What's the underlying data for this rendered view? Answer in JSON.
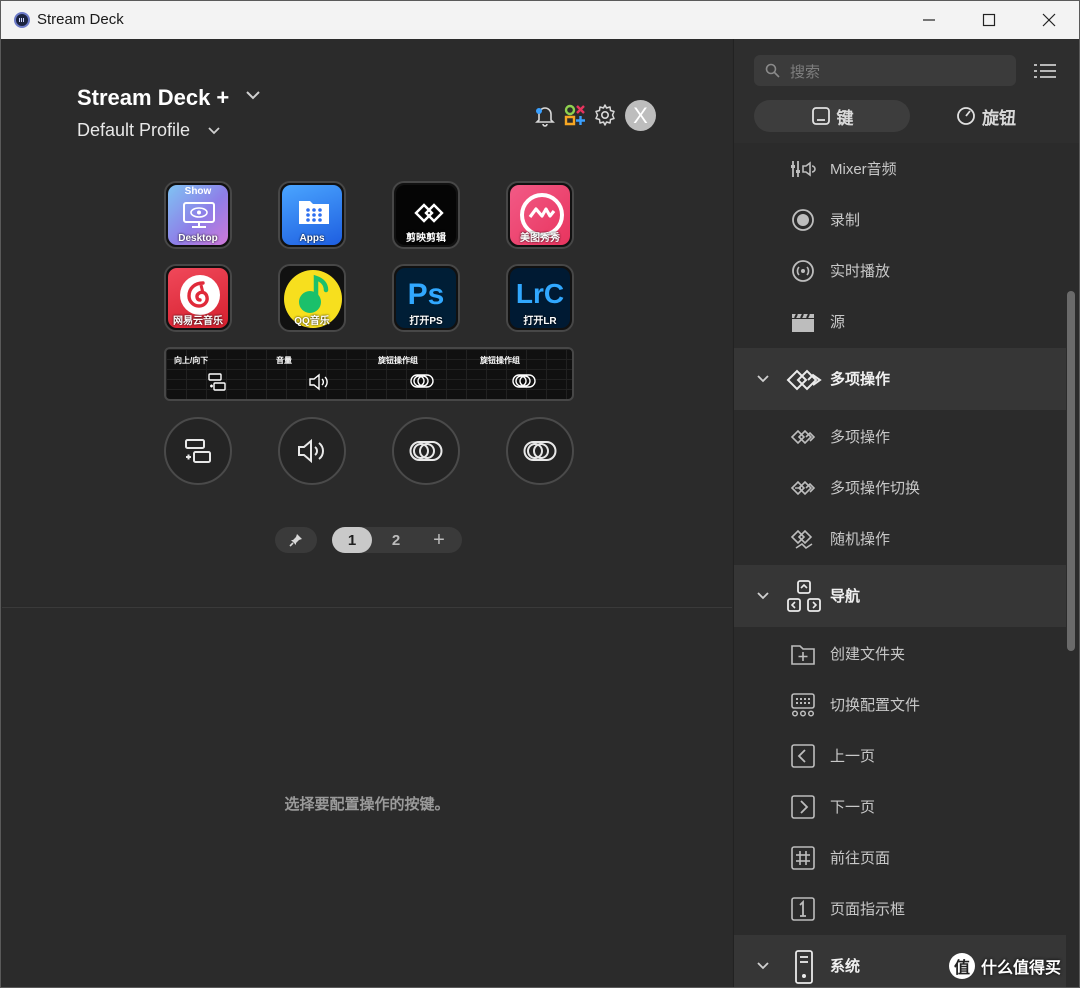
{
  "window": {
    "title": "Stream Deck",
    "minimize": "—",
    "maximize": "☐",
    "close": "✕"
  },
  "device": {
    "name": "Stream Deck +",
    "profile": "Default Profile"
  },
  "account": {
    "avatar_letter": "X"
  },
  "keys": [
    {
      "label": "Show   Desktop",
      "top": "Show",
      "bottom": "Desktop"
    },
    {
      "label": "Apps"
    },
    {
      "label": "剪映剪辑"
    },
    {
      "label": "美图秀秀"
    },
    {
      "label": "网易云音乐"
    },
    {
      "label": "QQ音乐"
    },
    {
      "label": "打开PS",
      "glyph": "Ps"
    },
    {
      "label": "打开LR",
      "glyph": "LrC"
    }
  ],
  "touchstrip": [
    "向上/向下",
    "音量",
    "旋钮操作组",
    "旋钮操作组"
  ],
  "pager": {
    "pages": [
      "1",
      "2",
      "+"
    ],
    "active": "1"
  },
  "empty_hint": "选择要配置操作的按键。",
  "sidebar": {
    "search_placeholder": "搜索",
    "tabs": [
      {
        "label": "键"
      },
      {
        "label": "旋钮"
      }
    ],
    "items": [
      {
        "label": "Mixer音频",
        "icon": "mixer-audio-icon"
      },
      {
        "label": "录制",
        "icon": "record-icon"
      },
      {
        "label": "实时播放",
        "icon": "live-icon"
      },
      {
        "label": "源",
        "icon": "clapper-icon"
      }
    ],
    "groups": [
      {
        "label": "多项操作",
        "items": [
          {
            "label": "多项操作"
          },
          {
            "label": "多项操作切换"
          },
          {
            "label": "随机操作"
          }
        ]
      },
      {
        "label": "导航",
        "items": [
          {
            "label": "创建文件夹"
          },
          {
            "label": "切换配置文件"
          },
          {
            "label": "上一页"
          },
          {
            "label": "下一页"
          },
          {
            "label": "前往页面"
          },
          {
            "label": "页面指示框"
          }
        ]
      },
      {
        "label": "系统"
      }
    ]
  },
  "watermark": {
    "logo": "值",
    "text": "什么值得买"
  },
  "colors": {
    "background": "#2b2b2b",
    "group_bg": "#363636",
    "accent_pink": "#e8345e",
    "ps_blue": "#31a8ff"
  }
}
